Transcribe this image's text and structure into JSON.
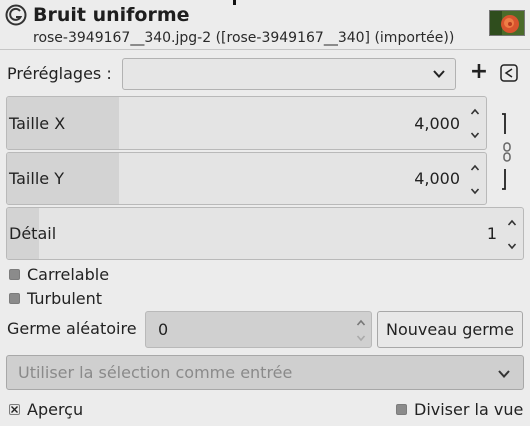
{
  "header": {
    "title": "Bruit uniforme",
    "subtitle": "rose-3949167__340.jpg-2 ([rose-3949167__340] (importée))"
  },
  "presets": {
    "label": "Préréglages :",
    "value": ""
  },
  "params": {
    "taille_x": {
      "label": "Taille X",
      "value": "4,000",
      "fill_fraction": 0.23
    },
    "taille_y": {
      "label": "Taille Y",
      "value": "4,000",
      "fill_fraction": 0.23
    },
    "detail": {
      "label": "Détail",
      "value": "1",
      "fill_fraction": 0.06
    }
  },
  "options": {
    "tileable": {
      "label": "Carrelable",
      "checked": false
    },
    "turbulent": {
      "label": "Turbulent",
      "checked": false
    }
  },
  "seed": {
    "label": "Germe aléatoire",
    "value": "0",
    "new_seed_label": "Nouveau germe"
  },
  "selection_input": {
    "label": "Utiliser la sélection comme entrée"
  },
  "footer": {
    "preview": {
      "label": "Aperçu",
      "checked": true
    },
    "split_view": {
      "label": "Diviser la vue",
      "checked": false
    }
  },
  "colors": {
    "background": "#ececec",
    "field": "#e4e4e4",
    "fill": "#d3d3d3",
    "disabled_text": "#8a8a8a"
  }
}
